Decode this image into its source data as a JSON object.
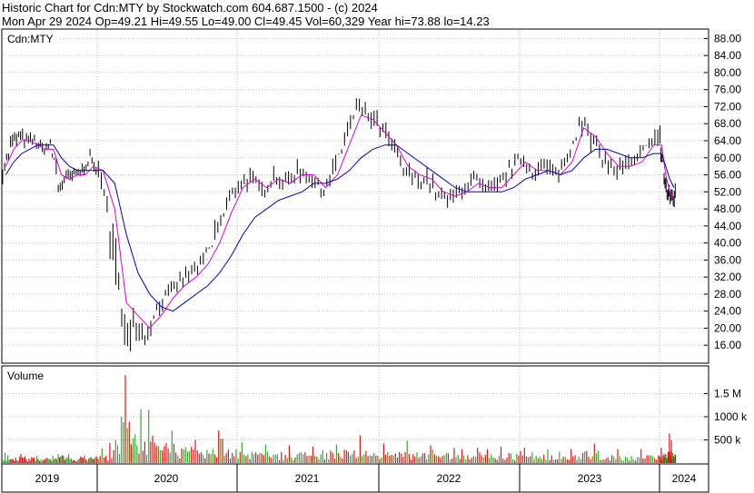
{
  "header": {
    "line1": "Historic Chart for Cdn:MTY by Stockwatch.com 604.687.1500 - (c) 2024",
    "line2": "Mon Apr 29 2024  Op=49.21  Hi=49.55  Lo=49.00  Cl=49.45  Vol=60,329  Year hi=73.88  lo=14.23"
  },
  "colors": {
    "price": "#000000",
    "ma_short": "#dd00dd",
    "ma_long": "#0000cc",
    "vol_up": "#33aa33",
    "vol_down": "#ee1111",
    "grid": "#bbbbbb"
  },
  "chart_data": [
    {
      "type": "line",
      "title": "Cdn:MTY",
      "y_ticks": [
        "88.00",
        "84.00",
        "80.00",
        "76.00",
        "72.00",
        "68.00",
        "64.00",
        "60.00",
        "56.00",
        "52.00",
        "48.00",
        "44.00",
        "40.00",
        "36.00",
        "32.00",
        "28.00",
        "24.00",
        "20.00",
        "16.00"
      ],
      "ylim": [
        12,
        90
      ],
      "x_labels": [
        "2019",
        "2020",
        "2021",
        "2022",
        "2023",
        "2024"
      ],
      "grid": true,
      "series": [
        {
          "name": "",
          "style": "price",
          "x": [
            "2019-01",
            "2019-02",
            "2019-03",
            "2019-04",
            "2019-05",
            "2019-06",
            "2019-07",
            "2019-08",
            "2019-09",
            "2019-10",
            "2019-11",
            "2019-12",
            "2020-01",
            "2020-02",
            "2020-03",
            "2020-04",
            "2020-05",
            "2020-06",
            "2020-07",
            "2020-08",
            "2020-09",
            "2020-10",
            "2020-11",
            "2020-12",
            "2021-01",
            "2021-02",
            "2021-03",
            "2021-04",
            "2021-05",
            "2021-06",
            "2021-07",
            "2021-08",
            "2021-09",
            "2021-10",
            "2021-11",
            "2021-12",
            "2022-01",
            "2022-02",
            "2022-03",
            "2022-04",
            "2022-05",
            "2022-06",
            "2022-07",
            "2022-08",
            "2022-09",
            "2022-10",
            "2022-11",
            "2022-12",
            "2023-01",
            "2023-02",
            "2023-03",
            "2023-04",
            "2023-05",
            "2023-06",
            "2023-07",
            "2023-08",
            "2023-09",
            "2023-10",
            "2023-11",
            "2023-12",
            "2024-01",
            "2024-02",
            "2024-03",
            "2024-04"
          ],
          "y": [
            57,
            63,
            65,
            64,
            64,
            62,
            63,
            53,
            55,
            56,
            57,
            60,
            56,
            45,
            20,
            22,
            18,
            25,
            28,
            31,
            33,
            36,
            42,
            49,
            54,
            55,
            52,
            56,
            54,
            57,
            56,
            52,
            57,
            65,
            72,
            70,
            67,
            63,
            57,
            55,
            55,
            51,
            50,
            53,
            55,
            52,
            53,
            57,
            60,
            57,
            58,
            56,
            60,
            70,
            64,
            60,
            57,
            58,
            59,
            65,
            64,
            55,
            51,
            51
          ],
          "range": [
            [
              54,
              60
            ],
            [
              60,
              66
            ],
            [
              63,
              68
            ],
            [
              62,
              66
            ],
            [
              62,
              66
            ],
            [
              60,
              64
            ],
            [
              61,
              65
            ],
            [
              51,
              56
            ],
            [
              53,
              58
            ],
            [
              54,
              58
            ],
            [
              55,
              59
            ],
            [
              57,
              62
            ],
            [
              52,
              59
            ],
            [
              30,
              56
            ],
            [
              15,
              28
            ],
            [
              18,
              26
            ],
            [
              15,
              22
            ],
            [
              22,
              28
            ],
            [
              25,
              30
            ],
            [
              28,
              34
            ],
            [
              30,
              36
            ],
            [
              33,
              38
            ],
            [
              38,
              46
            ],
            [
              45,
              52
            ],
            [
              51,
              57
            ],
            [
              52,
              58
            ],
            [
              49,
              55
            ],
            [
              53,
              59
            ],
            [
              51,
              57
            ],
            [
              54,
              60
            ],
            [
              53,
              59
            ],
            [
              49,
              55
            ],
            [
              53,
              60
            ],
            [
              61,
              69
            ],
            [
              68,
              73
            ],
            [
              66,
              73
            ],
            [
              63,
              70
            ],
            [
              59,
              66
            ],
            [
              54,
              60
            ],
            [
              52,
              58
            ],
            [
              51,
              58
            ],
            [
              48,
              54
            ],
            [
              47,
              53
            ],
            [
              50,
              56
            ],
            [
              52,
              58
            ],
            [
              49,
              55
            ],
            [
              50,
              56
            ],
            [
              53,
              60
            ],
            [
              57,
              63
            ],
            [
              54,
              60
            ],
            [
              55,
              61
            ],
            [
              53,
              59
            ],
            [
              56,
              63
            ],
            [
              66,
              74
            ],
            [
              60,
              68
            ],
            [
              57,
              63
            ],
            [
              54,
              60
            ],
            [
              55,
              61
            ],
            [
              56,
              62
            ],
            [
              61,
              68
            ],
            [
              60,
              68
            ],
            [
              51,
              58
            ],
            [
              48,
              54
            ],
            [
              45,
              53
            ]
          ]
        },
        {
          "name": "",
          "style": "ma_short",
          "y": [
            58,
            62,
            64,
            64,
            63,
            62,
            62,
            56,
            55,
            56,
            56,
            58,
            57,
            48,
            26,
            23,
            20,
            23,
            27,
            30,
            32,
            35,
            40,
            47,
            53,
            55,
            53,
            55,
            54,
            56,
            56,
            53,
            56,
            63,
            70,
            69,
            66,
            63,
            58,
            56,
            55,
            52,
            51,
            52,
            54,
            53,
            53,
            56,
            59,
            57,
            57,
            56,
            59,
            67,
            65,
            61,
            58,
            58,
            59,
            63,
            63,
            56,
            52,
            50
          ]
        },
        {
          "name": "",
          "style": "ma_long",
          "y": [
            56,
            59,
            61,
            62,
            63,
            63,
            63,
            60,
            58,
            57,
            57,
            57,
            57,
            54,
            42,
            33,
            28,
            25,
            24,
            26,
            28,
            30,
            33,
            37,
            42,
            46,
            48,
            50,
            51,
            52,
            54,
            54,
            55,
            57,
            60,
            62,
            63,
            63,
            61,
            59,
            57,
            55,
            53,
            52,
            52,
            52,
            52,
            53,
            55,
            56,
            57,
            56,
            57,
            60,
            62,
            62,
            61,
            60,
            60,
            61,
            61,
            58,
            55,
            53
          ]
        }
      ]
    },
    {
      "type": "bar",
      "title": "Volume",
      "y_ticks": [
        "1.5 M",
        "1000 k",
        "500 k"
      ],
      "y_tick_values": [
        1500000,
        1000000,
        500000
      ],
      "ylim": [
        0,
        2000000
      ],
      "months": [
        "2019-01",
        "2019-02",
        "2019-03",
        "2019-04",
        "2019-05",
        "2019-06",
        "2019-07",
        "2019-08",
        "2019-09",
        "2019-10",
        "2019-11",
        "2019-12",
        "2020-01",
        "2020-02",
        "2020-03",
        "2020-04",
        "2020-05",
        "2020-06",
        "2020-07",
        "2020-08",
        "2020-09",
        "2020-10",
        "2020-11",
        "2020-12",
        "2021-01",
        "2021-02",
        "2021-03",
        "2021-04",
        "2021-05",
        "2021-06",
        "2021-07",
        "2021-08",
        "2021-09",
        "2021-10",
        "2021-11",
        "2021-12",
        "2022-01",
        "2022-02",
        "2022-03",
        "2022-04",
        "2022-05",
        "2022-06",
        "2022-07",
        "2022-08",
        "2022-09",
        "2022-10",
        "2022-11",
        "2022-12",
        "2023-01",
        "2023-02",
        "2023-03",
        "2023-04",
        "2023-05",
        "2023-06",
        "2023-07",
        "2023-08",
        "2023-09",
        "2023-10",
        "2023-11",
        "2023-12",
        "2024-01",
        "2024-02",
        "2024-03",
        "2024-04"
      ],
      "typical": [
        90000,
        80000,
        90000,
        70000,
        80000,
        70000,
        70000,
        120000,
        90000,
        80000,
        80000,
        90000,
        120000,
        260000,
        650000,
        500000,
        380000,
        300000,
        260000,
        230000,
        200000,
        220000,
        230000,
        210000,
        160000,
        150000,
        170000,
        150000,
        140000,
        150000,
        130000,
        180000,
        150000,
        200000,
        190000,
        170000,
        160000,
        150000,
        160000,
        140000,
        140000,
        150000,
        120000,
        130000,
        120000,
        140000,
        130000,
        140000,
        120000,
        120000,
        110000,
        120000,
        120000,
        170000,
        150000,
        120000,
        110000,
        110000,
        110000,
        120000,
        120000,
        130000,
        170000,
        150000
      ],
      "peak": [
        220000,
        180000,
        200000,
        170000,
        160000,
        150000,
        160000,
        380000,
        200000,
        180000,
        170000,
        200000,
        320000,
        700000,
        1900000,
        1500000,
        1150000,
        850000,
        700000,
        600000,
        500000,
        650000,
        700000,
        600000,
        450000,
        420000,
        400000,
        380000,
        380000,
        400000,
        350000,
        500000,
        400000,
        780000,
        600000,
        500000,
        420000,
        400000,
        480000,
        380000,
        380000,
        420000,
        330000,
        380000,
        330000,
        400000,
        350000,
        420000,
        330000,
        320000,
        300000,
        330000,
        300000,
        520000,
        420000,
        330000,
        300000,
        300000,
        300000,
        330000,
        330000,
        400000,
        640000,
        420000
      ]
    }
  ]
}
